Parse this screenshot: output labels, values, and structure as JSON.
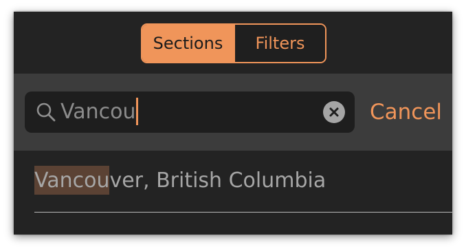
{
  "segmented_control": {
    "sections_label": "Sections",
    "filters_label": "Filters",
    "selected": "Sections"
  },
  "search": {
    "value": "Vancou",
    "clear_icon": "clear-circle-x-icon",
    "search_icon": "magnifier-icon",
    "cancel_label": "Cancel"
  },
  "results": [
    {
      "match": "Vancou",
      "rest": "ver, British Columbia"
    }
  ],
  "colors": {
    "accent": "#f0955a",
    "background": "#232323",
    "searchbar": "#3c3c3c",
    "field": "#1e1e1e",
    "highlight": "#5b4234",
    "text_secondary": "#a6a6a6"
  }
}
